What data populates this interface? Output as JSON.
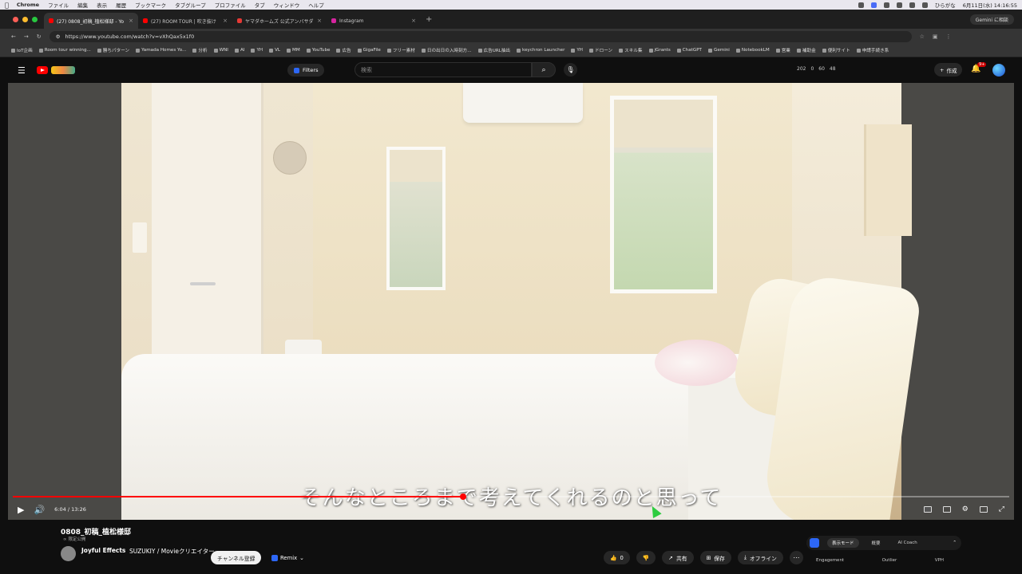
{
  "macos": {
    "app_name": "Chrome",
    "menus": [
      "ファイル",
      "編集",
      "表示",
      "履歴",
      "ブックマーク",
      "タブグループ",
      "プロファイル",
      "タブ",
      "ウィンドウ",
      "ヘルプ"
    ],
    "ime": "ひらがな",
    "clock": "6月11日(水) 14:16:55"
  },
  "browser": {
    "tabs": [
      {
        "title": "(27) 0808_初稿_植松様邸 - Yo",
        "favicon_color": "#ff0000",
        "active": true
      },
      {
        "title": "(27) ROOM TOUR | 吹き抜け",
        "favicon_color": "#ff0000",
        "active": false
      },
      {
        "title": "ヤマダホームズ 公式アンバサダー",
        "favicon_color": "#e53935",
        "active": false
      },
      {
        "title": "Instagram",
        "favicon_color": "#d6249f",
        "active": false
      }
    ],
    "gemini_button": "Gemini に相談",
    "url": "https://www.youtube.com/watch?v=vXhQax5x1f0",
    "bookmarks": [
      "IoT企画",
      "Room tour winning...",
      "勝ちパターン",
      "Yamada Homes Yo...",
      "分析",
      "WNI",
      "AI",
      "YH",
      "VL",
      "MM",
      "YouTube",
      "広告",
      "GigaFile",
      "フリー素材",
      "日の出日の入時刻方...",
      "広告URL抽出",
      "keychron Launcher",
      "YH",
      "ドローン",
      "スキル集",
      "jGrants",
      "ChatGPT",
      "Gemini",
      "NotebookLM",
      "営業",
      "補助金",
      "便利サイト",
      "申請手続き系"
    ]
  },
  "youtube": {
    "filters_label": "Filters",
    "search_placeholder": "検索",
    "stats": [
      "202",
      "0",
      "60",
      "48"
    ],
    "create_label": "作成",
    "notification_count": "9+"
  },
  "player": {
    "subtitle": "そんなところまで考えてくれるのと思って",
    "current_time": "6:04",
    "duration": "13:26",
    "progress_fraction": 0.4516
  },
  "video": {
    "title": "0808_初稿_植松様邸",
    "visibility": "限定公開",
    "channel_name": "Joyful Effects",
    "channel_desc": "SUZUKIY / Movieクリエイター",
    "subscribe_label": "チャンネル登録",
    "remix_label": "Remix",
    "like_count": "0",
    "share_label": "共有",
    "save_label": "保存",
    "offline_label": "オフライン"
  },
  "extension": {
    "segments": [
      "表示モード",
      "概要",
      "AI Coach"
    ],
    "columns": [
      "Engagement",
      "Outlier",
      "VPH"
    ]
  }
}
